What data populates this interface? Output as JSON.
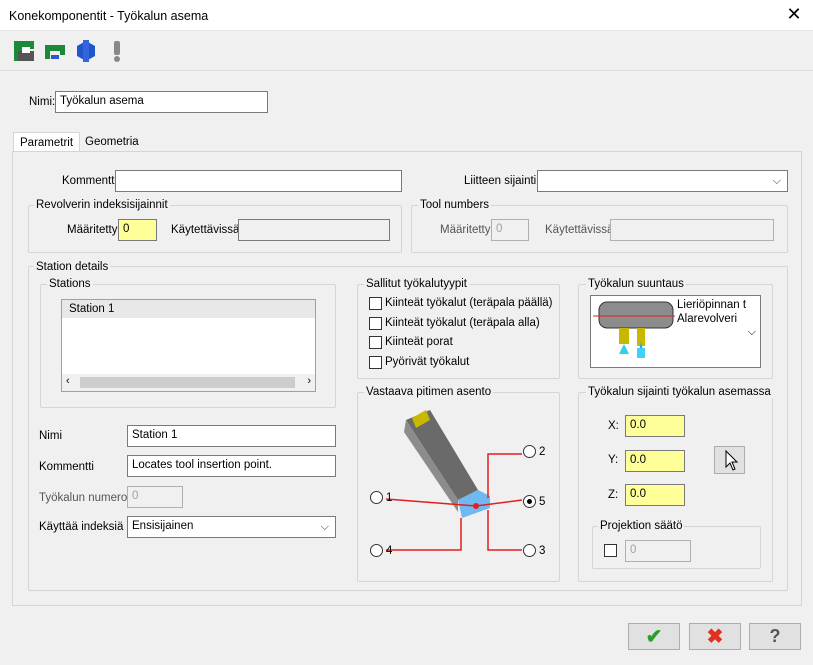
{
  "window": {
    "title": "Konekomponentit - Työkalun asema",
    "close": "✕"
  },
  "header": {
    "name_label": "Nimi:",
    "name_value": "Työkalun asema"
  },
  "tabs": [
    {
      "label": "Parametrit"
    },
    {
      "label": "Geometria"
    }
  ],
  "params": {
    "comment_label": "Kommentti",
    "comment_value": "",
    "attach_label": "Liitteen sijainti",
    "attach_value": "",
    "revolver_group": "Revolverin indeksisijainnit",
    "defined_label": "Määritetty",
    "defined_value": "0",
    "available_label": "Käytettävissä",
    "available_value": "",
    "toolnum_group": "Tool numbers",
    "tn_defined_label": "Määritetty",
    "tn_defined_value": "0",
    "tn_available_label": "Käytettävissä",
    "tn_available_value": ""
  },
  "station": {
    "group": "Station details",
    "stations_group": "Stations",
    "list": [
      "Station 1"
    ],
    "name_label": "Nimi",
    "name_value": "Station 1",
    "comment_label": "Kommentti",
    "comment_value": "Locates tool insertion point.",
    "toolnum_label": "Työkalun numero",
    "toolnum_value": "0",
    "index_label": "Käyttää indeksiä",
    "index_value": "Ensisijainen"
  },
  "allowed": {
    "group": "Sallitut työkalutyypit",
    "items": [
      "Kiinteät työkalut (teräpala päällä)",
      "Kiinteät työkalut (teräpala alla)",
      "Kiinteät porat",
      "Pyörivät työkalut"
    ]
  },
  "orientation": {
    "group": "Työkalun suuntaus",
    "line1": "Lieriöpinnan t",
    "line2": "Alarevolveri"
  },
  "holder": {
    "group": "Vastaava pitimen asento",
    "opt1": "1",
    "opt2": "2",
    "opt3": "3",
    "opt4": "4",
    "opt5": "5",
    "selected": "5"
  },
  "position": {
    "group": "Työkalun sijainti työkalun asemassa",
    "x_label": "X:",
    "x_value": "0.0",
    "y_label": "Y:",
    "y_value": "0.0",
    "z_label": "Z:",
    "z_value": "0.0",
    "proj_group": "Projektion säätö",
    "proj_value": "0"
  },
  "icons": {
    "toolbar": [
      "station-icon",
      "holder-icon",
      "nut-icon",
      "warning-icon"
    ],
    "ok": "✔",
    "cancel": "✖",
    "help": "?"
  },
  "colors": {
    "ok": "#2aa02a",
    "cancel": "#e03020",
    "highlight": "#ffff99",
    "red_line": "#e02020"
  }
}
